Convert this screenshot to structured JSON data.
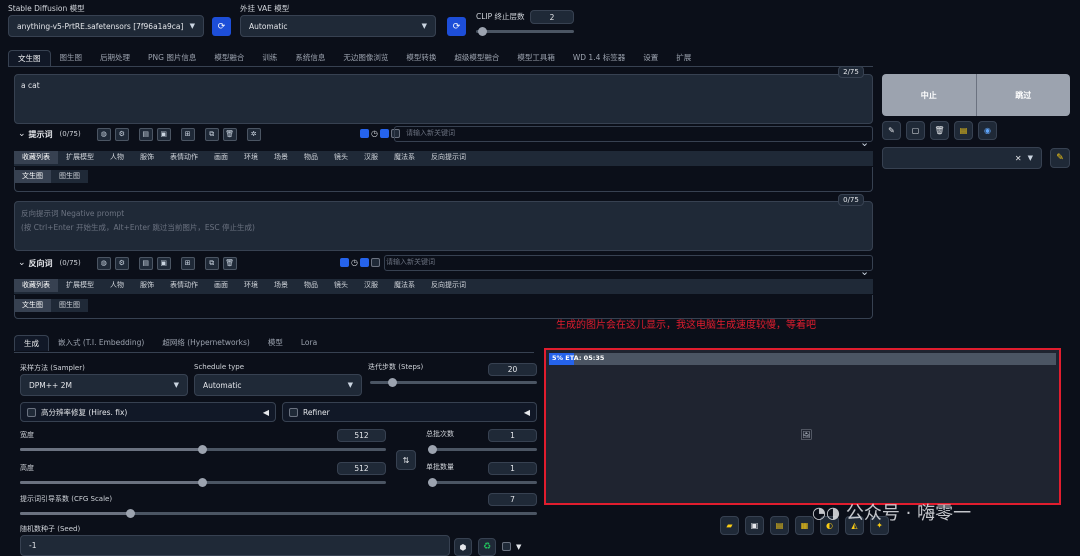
{
  "top": {
    "sd_model_label": "Stable Diffusion 模型",
    "sd_model_value": "anything-v5-PrtRE.safetensors [7f96a1a9ca]",
    "vae_label": "外挂 VAE 模型",
    "vae_value": "Automatic",
    "clip_label": "CLIP 终止层数",
    "clip_value": "2"
  },
  "main_tabs": [
    "文生图",
    "图生图",
    "后期处理",
    "PNG 图片信息",
    "模型融合",
    "训练",
    "系统信息",
    "无边图像浏览",
    "模型转换",
    "超级模型融合",
    "模型工具箱",
    "WD 1.4 标签器",
    "设置",
    "扩展"
  ],
  "prompt": {
    "text": "a cat",
    "counter": "2/75",
    "label": "提示词",
    "count": "(0/75)",
    "keyword_placeholder": "请输入新关键词"
  },
  "negative": {
    "placeholder_line1": "反向提示词 Negative prompt",
    "placeholder_line2": "(按 Ctrl+Enter 开始生成，Alt+Enter 跳过当前图片，ESC 停止生成)",
    "counter": "0/75",
    "label": "反向词",
    "count": "(0/75)",
    "keyword_placeholder": "请输入新关键词"
  },
  "category_tabs": [
    "收藏列表",
    "扩展模型",
    "人物",
    "服饰",
    "表情动作",
    "画面",
    "环境",
    "场景",
    "物品",
    "镜头",
    "汉服",
    "魔法系",
    "反向提示词"
  ],
  "sub_tabs": [
    "文生图",
    "图生图"
  ],
  "side": {
    "interrupt": "中止",
    "skip": "跳过"
  },
  "gen_tabs": [
    "生成",
    "嵌入式 (T.I. Embedding)",
    "超网络 (Hypernetworks)",
    "模型",
    "Lora"
  ],
  "settings": {
    "sampler_label": "采样方法 (Sampler)",
    "sampler_value": "DPM++ 2M",
    "schedule_label": "Schedule type",
    "schedule_value": "Automatic",
    "steps_label": "迭代步数 (Steps)",
    "steps_value": "20",
    "hires_label": "高分辨率修复 (Hires. fix)",
    "refiner_label": "Refiner",
    "width_label": "宽度",
    "width_value": "512",
    "height_label": "高度",
    "height_value": "512",
    "batch_count_label": "总批次数",
    "batch_count_value": "1",
    "batch_size_label": "单批数量",
    "batch_size_value": "1",
    "cfg_label": "提示词引导系数 (CFG Scale)",
    "cfg_value": "7",
    "seed_label": "随机数种子 (Seed)",
    "seed_value": "-1"
  },
  "output": {
    "progress_text": "5% ETA: 05:35",
    "progress_percent": 5,
    "annotation": "生成的图片会在这儿显示，我这电脑生成速度较慢，等着吧"
  },
  "watermark": "公众号 · 嗨零一",
  "colors": {
    "accent": "#1d4ed8",
    "annotation": "#e11d2e"
  }
}
